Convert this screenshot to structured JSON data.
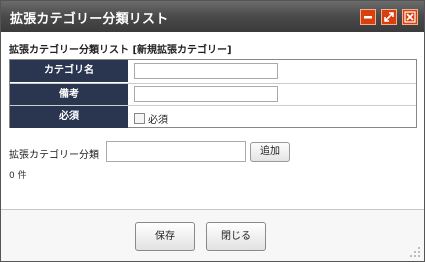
{
  "window": {
    "title": "拡張カテゴリー分類リスト",
    "controls": [
      "minimize-icon",
      "maximize-icon",
      "close-icon"
    ],
    "accent_color": "#d9400d"
  },
  "form": {
    "heading": "拡張カテゴリー分類リスト [新規拡張カテゴリー]",
    "fields": [
      {
        "label": "カテゴリ名",
        "value": "",
        "placeholder": ""
      },
      {
        "label": "備考",
        "value": "",
        "placeholder": ""
      },
      {
        "label": "必須",
        "checkbox_label": "必須",
        "checked": false
      }
    ],
    "label_bg_color": "#2a3550"
  },
  "extension": {
    "label": "拡張カテゴリー分類",
    "value": "",
    "add_label": "追加",
    "count_text": "0 件"
  },
  "footer": {
    "save_label": "保存",
    "close_label": "閉じる"
  }
}
